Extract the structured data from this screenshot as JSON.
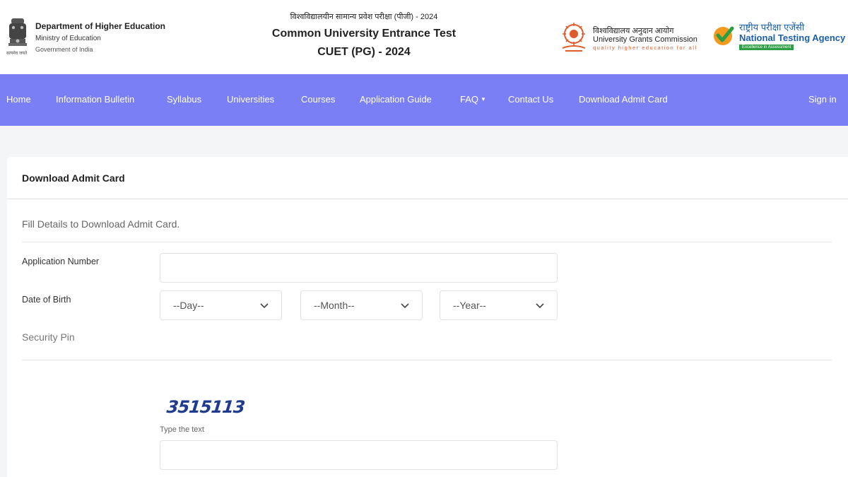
{
  "header": {
    "dept_line1": "Department of Higher Education",
    "dept_line2": "Ministry of Education",
    "dept_line3": "Government of India",
    "emblem_motto": "सत्यमेव जयते",
    "title_hindi": "विश्वविद्यालयीन सामान्य प्रवेश परीक्षा (पीजी) - 2024",
    "title_line1": "Common University Entrance Test",
    "title_line2": "CUET (PG) - 2024",
    "ugc_hindi": "विश्वविद्यालय अनुदान आयोग",
    "ugc_name": "University Grants Commission",
    "ugc_tagline": "quality higher education for all",
    "nta_hindi": "राष्ट्रीय परीक्षा एजेंसी",
    "nta_name": "National Testing Agency",
    "nta_tagline": "Excellence in Assessment"
  },
  "nav": {
    "items": [
      "Home",
      "Information Bulletin",
      "Syllabus",
      "Universities",
      "Courses",
      "Application Guide",
      "FAQ",
      "Contact Us",
      "Download Admit Card"
    ],
    "signin": "Sign in"
  },
  "card": {
    "title": "Download Admit Card",
    "instruction": "Fill Details to Download Admit Card.",
    "application_label": "Application Number",
    "application_value": "",
    "dob_label": "Date of Birth",
    "day_selected": "--Day--",
    "month_selected": "--Month--",
    "year_selected": "--Year--",
    "security_label": "Security Pin",
    "captcha_text": "3515113",
    "type_text_label": "Type the text",
    "captcha_input_value": ""
  },
  "colors": {
    "nav_bg": "#7b7ff5",
    "page_bg": "#f4f5f7",
    "nta_blue": "#1d5fa8",
    "captcha_blue": "#1f3b8f"
  },
  "icons": {
    "emblem": "national-emblem-icon",
    "ugc": "ugc-logo-icon",
    "nta": "nta-checkmark-logo-icon",
    "dropdown": "chevron-down-icon",
    "faq_caret": "caret-down-icon"
  }
}
